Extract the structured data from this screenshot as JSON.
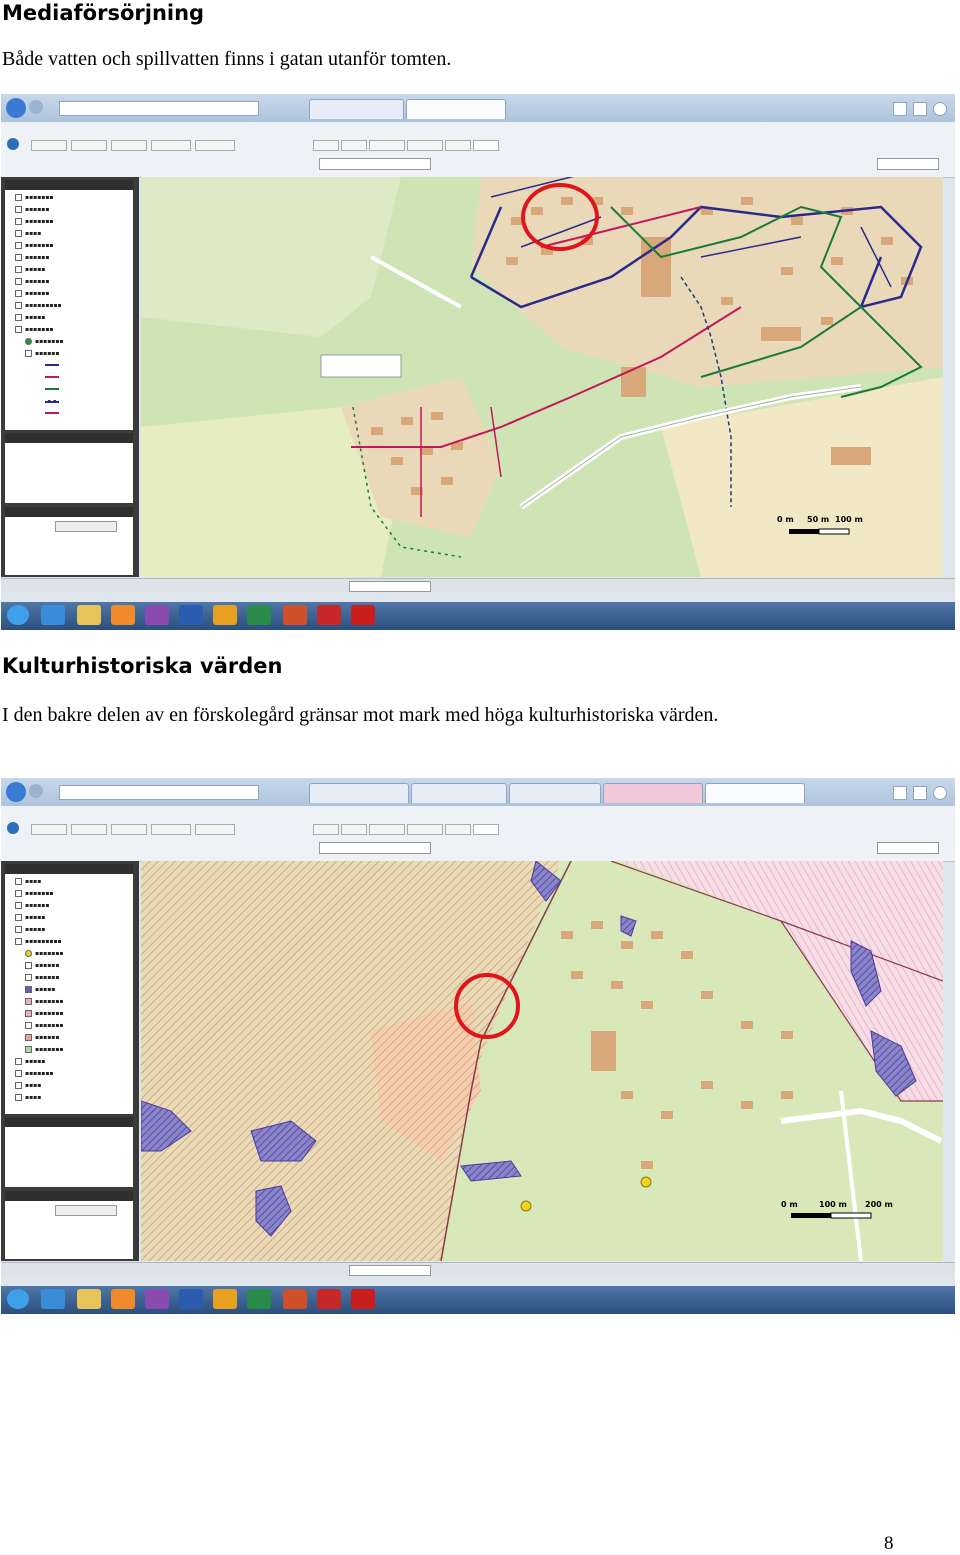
{
  "section1": {
    "heading": "Mediaförsörjning",
    "text": "Både vatten och spillvatten finns i gatan utanför tomten."
  },
  "section2": {
    "heading": "Kulturhistoriska värden",
    "text": "I den bakre delen av en förskolegård gränsar mot mark med höga kulturhistoriska värden."
  },
  "screenshot1": {
    "scale": {
      "label_0": "0 m",
      "label_1": "50 m",
      "label_2": "100 m"
    },
    "colors": {
      "water_line": "#2a2a8c",
      "waste_line": "#c2185b",
      "storm_line": "#1b7a3a",
      "highlight": "#e0141b"
    },
    "icons": [
      "back-icon",
      "forward-icon",
      "home-icon",
      "star-icon",
      "gear-icon"
    ]
  },
  "screenshot2": {
    "scale": {
      "label_0": "0 m",
      "label_1": "100 m",
      "label_2": "200 m"
    },
    "colors": {
      "cultural_area": "#e8b0c0",
      "ancient_remains": "#6b5bb5",
      "highlight": "#e0141b"
    },
    "icons": [
      "back-icon",
      "forward-icon",
      "home-icon",
      "star-icon",
      "gear-icon"
    ]
  },
  "page_number": "8"
}
